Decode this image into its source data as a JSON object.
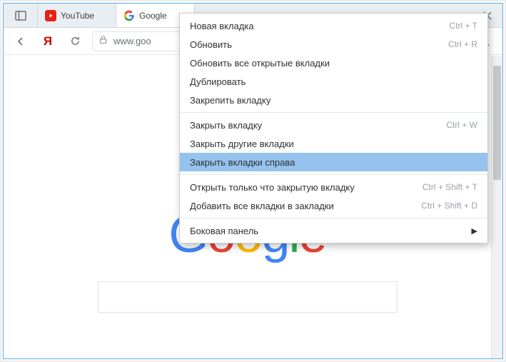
{
  "tabs": [
    {
      "label": "YouTube",
      "active": false
    },
    {
      "label": "Google",
      "active": true
    }
  ],
  "toolbar": {
    "yandex_label": "Я",
    "url": "www.goo"
  },
  "context_menu": {
    "items": [
      {
        "label": "Новая вкладка",
        "shortcut": "Ctrl + T"
      },
      {
        "label": "Обновить",
        "shortcut": "Ctrl + R"
      },
      {
        "label": "Обновить все открытые вкладки",
        "shortcut": ""
      },
      {
        "label": "Дублировать",
        "shortcut": ""
      },
      {
        "label": "Закрепить вкладку",
        "shortcut": ""
      },
      "---",
      {
        "label": "Закрыть вкладку",
        "shortcut": "Ctrl + W"
      },
      {
        "label": "Закрыть другие вкладки",
        "shortcut": ""
      },
      {
        "label": "Закрыть вкладки справа",
        "shortcut": "",
        "highlight": true
      },
      "---",
      {
        "label": "Открыть только что закрытую вкладку",
        "shortcut": "Ctrl + Shift + T"
      },
      {
        "label": "Добавить все вкладки в закладки",
        "shortcut": "Ctrl + Shift + D"
      },
      "---",
      {
        "label": "Боковая панель",
        "shortcut": "",
        "submenu": true
      }
    ]
  },
  "logo": {
    "c0": "G",
    "c1": "o",
    "c2": "o",
    "c3": "g",
    "c4": "l",
    "c5": "e"
  }
}
